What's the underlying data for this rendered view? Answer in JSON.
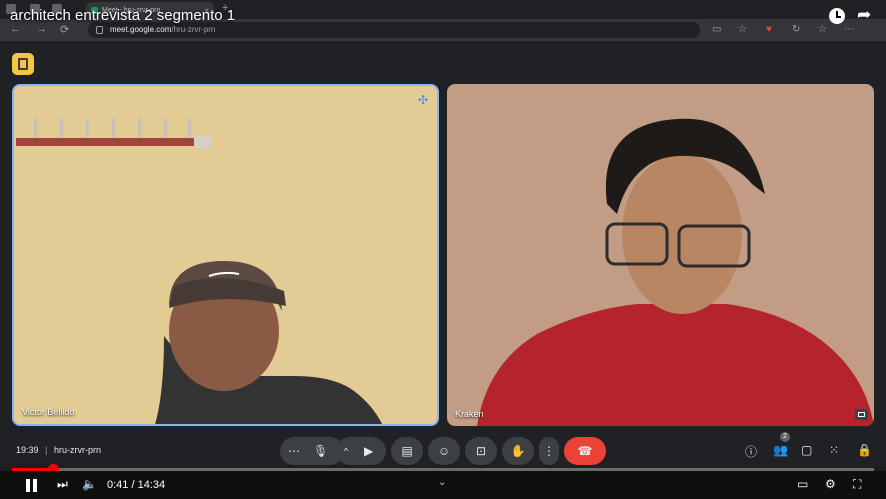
{
  "browser": {
    "tab_title": "Meet - hru-zrvr-prn",
    "url_host": "meet.google.com",
    "url_path": "/hru-zrvr-prn"
  },
  "video": {
    "title": "architech entrevista 2 segmento 1",
    "current_time": "0:41",
    "duration": "14:34",
    "time_display": "0:41 / 14:34",
    "progress": 0.047
  },
  "meeting": {
    "clock": "19:39",
    "code": "hru-zrvr-prn",
    "participant_count": "2",
    "participants": [
      {
        "name": "Victor Bellido"
      },
      {
        "name": "Kraken"
      }
    ]
  },
  "colors": {
    "hangup": "#ea4335",
    "active_speaker_border": "#8ab4f8",
    "progress": "#ff0000",
    "badge": "#f6c544"
  },
  "icons": {
    "controls": [
      "more-icon",
      "mic-icon",
      "chevron-up-icon",
      "camera-icon",
      "captions-icon",
      "emoji-icon",
      "present-icon",
      "raise-hand-icon",
      "more-vert-icon",
      "end-call-icon"
    ],
    "right": [
      "info-icon",
      "people-icon",
      "chat-icon",
      "activities-icon",
      "host-controls-icon"
    ],
    "player": [
      "pause-icon",
      "next-icon",
      "volume-icon",
      "subtitles-icon",
      "settings-icon",
      "fullscreen-icon"
    ]
  }
}
